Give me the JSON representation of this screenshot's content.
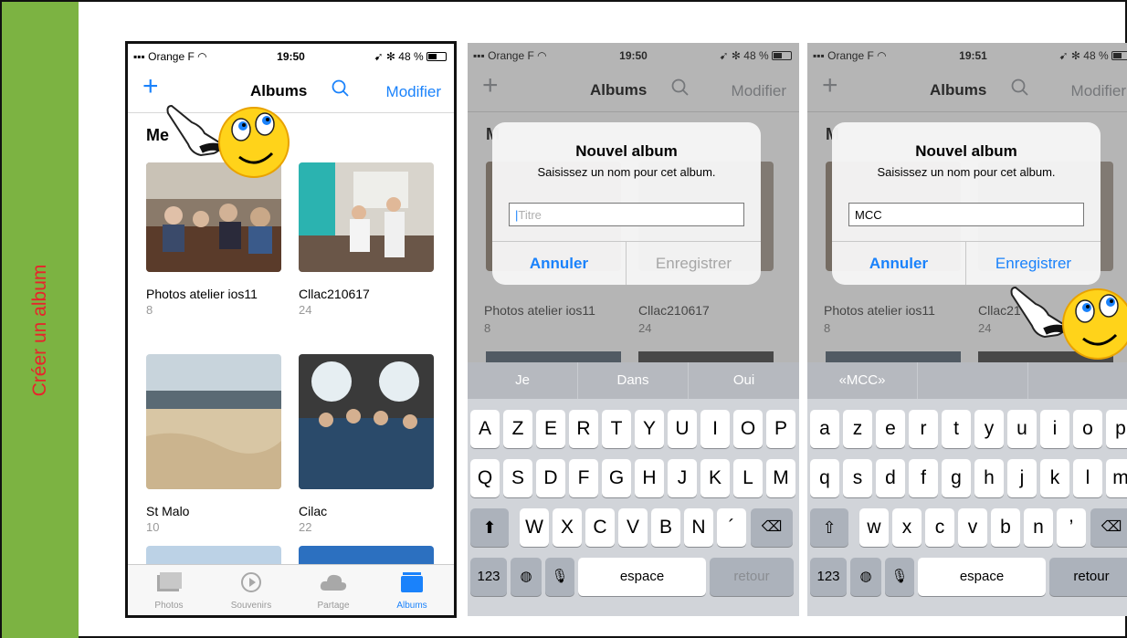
{
  "slide": {
    "side_title": "Créer un album"
  },
  "phone1": {
    "status": {
      "carrier": "Orange F",
      "time": "19:50",
      "right": "48 %"
    },
    "nav": {
      "plus": "+",
      "title": "Albums",
      "edit": "Modifier"
    },
    "section": "Me",
    "albums": [
      {
        "name": "Photos atelier ios11",
        "count": "8"
      },
      {
        "name": "Cllac210617",
        "count": "24"
      },
      {
        "name": "St Malo",
        "count": "10"
      },
      {
        "name": "Cilac",
        "count": "22"
      }
    ],
    "tabs": [
      {
        "label": "Photos",
        "icon": "photos-icon"
      },
      {
        "label": "Souvenirs",
        "icon": "memories-icon"
      },
      {
        "label": "Partage",
        "icon": "cloud-icon"
      },
      {
        "label": "Albums",
        "icon": "albums-icon"
      }
    ]
  },
  "phone2": {
    "status": {
      "carrier": "Orange F",
      "time": "19:50",
      "right": "48 %"
    },
    "nav": {
      "plus": "+",
      "title": "Albums",
      "edit": "Modifier"
    },
    "section": "M",
    "albums": [
      {
        "name": "Photos atelier ios11",
        "count": "8"
      },
      {
        "name": "Cllac210617",
        "count": "24"
      }
    ],
    "alert": {
      "title": "Nouvel album",
      "message": "Saisissez un nom pour cet album.",
      "placeholder": "Titre",
      "value": "",
      "cancel": "Annuler",
      "save": "Enregistrer"
    },
    "suggestions": [
      "Je",
      "Dans",
      "Oui"
    ],
    "rows": [
      [
        "A",
        "Z",
        "E",
        "R",
        "T",
        "Y",
        "U",
        "I",
        "O",
        "P"
      ],
      [
        "Q",
        "S",
        "D",
        "F",
        "G",
        "H",
        "J",
        "K",
        "L",
        "M"
      ],
      [
        "W",
        "X",
        "C",
        "V",
        "B",
        "N",
        "´"
      ]
    ],
    "bottom": {
      "numbers": "123",
      "space": "espace",
      "return": "retour"
    }
  },
  "phone3": {
    "status": {
      "carrier": "Orange F",
      "time": "19:51",
      "right": "48 %"
    },
    "nav": {
      "plus": "+",
      "title": "Albums",
      "edit": "Modifier"
    },
    "section": "M",
    "albums": [
      {
        "name": "Photos atelier ios11",
        "count": "8"
      },
      {
        "name": "Cllac21",
        "count": "24"
      }
    ],
    "alert": {
      "title": "Nouvel album",
      "message": "Saisissez un nom pour cet album.",
      "value": "MCC",
      "cancel": "Annuler",
      "save": "Enregistrer"
    },
    "suggestions": [
      "«MCC»",
      "",
      ""
    ],
    "rows": [
      [
        "a",
        "z",
        "e",
        "r",
        "t",
        "y",
        "u",
        "i",
        "o",
        "p"
      ],
      [
        "q",
        "s",
        "d",
        "f",
        "g",
        "h",
        "j",
        "k",
        "l",
        "m"
      ],
      [
        "w",
        "x",
        "c",
        "v",
        "b",
        "n",
        "’"
      ]
    ],
    "bottom": {
      "numbers": "123",
      "space": "espace",
      "return": "retour"
    }
  },
  "colors": {
    "accent": "#1a82fb",
    "side_band": "#7cb342",
    "side_title": "#e8232b"
  }
}
